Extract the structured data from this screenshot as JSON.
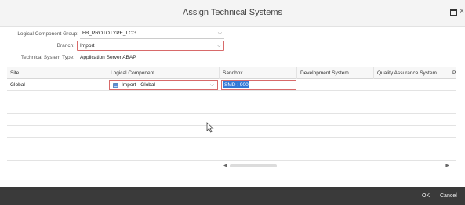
{
  "dialog": {
    "title": "Assign Technical Systems",
    "icons": {
      "maximize": "maximize-icon",
      "close": "close-icon"
    }
  },
  "form": {
    "logical_component_group": {
      "label": "Logical Component Group:",
      "value": "FB_PROTOTYPE_LCG"
    },
    "branch": {
      "label": "Branch:",
      "value": "Import"
    },
    "technical_system_type": {
      "label": "Technical System Type:",
      "value": "Application Server ABAP"
    }
  },
  "table": {
    "columns": [
      "Site",
      "Logical Component",
      "Sandbox",
      "Development System",
      "Quality Assurance System",
      "Pr"
    ],
    "rows": [
      {
        "site": "Global",
        "logical_component": "Import - Global",
        "sandbox": "SMD : 900",
        "development": "",
        "qa": "",
        "pr": ""
      }
    ]
  },
  "footer": {
    "ok_label": "OK",
    "cancel_label": "Cancel"
  },
  "colors": {
    "highlight": "#d86a6a",
    "selection": "#3478d6",
    "footer_bg": "#3a3a3a"
  }
}
